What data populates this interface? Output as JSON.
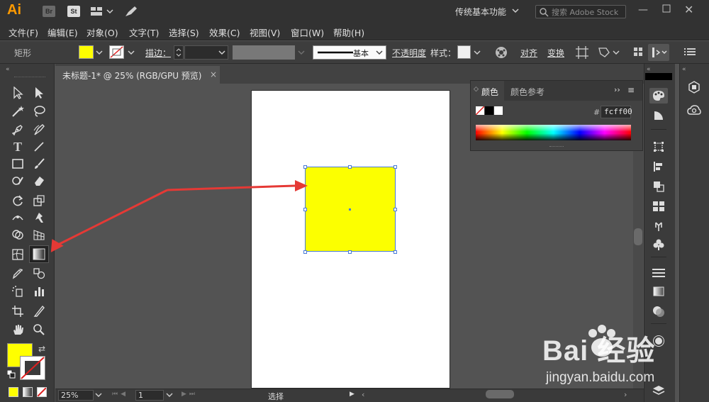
{
  "app": {
    "logo": "Ai",
    "bridge_label": "Br",
    "stock_label": "St",
    "workspace": "传统基本功能",
    "search_placeholder": "搜索 Adobe Stock"
  },
  "menu": [
    "文件(F)",
    "编辑(E)",
    "对象(O)",
    "文字(T)",
    "选择(S)",
    "效果(C)",
    "视图(V)",
    "窗口(W)",
    "帮助(H)"
  ],
  "control": {
    "object_type": "矩形",
    "fill_color": "#ffff00",
    "stroke_label": "描边：",
    "brush_label": "基本",
    "opacity_label": "不透明度",
    "style_label": "样式：",
    "align_label": "对齐",
    "transform_label": "变换"
  },
  "document": {
    "tab_title": "未标题-1* @ 25% (RGB/GPU 预览)",
    "close_symbol": "×"
  },
  "color_panel": {
    "tab_color": "颜色",
    "tab_guide": "颜色参考",
    "hex_symbol": "#",
    "hex_value": "fcff00",
    "selected_fill": "#fcff00"
  },
  "status": {
    "zoom": "25%",
    "artboard_number": "1",
    "tool_name": "选择"
  },
  "watermark": {
    "main": "Bai 经验",
    "url": "jingyan.baidu.com"
  }
}
